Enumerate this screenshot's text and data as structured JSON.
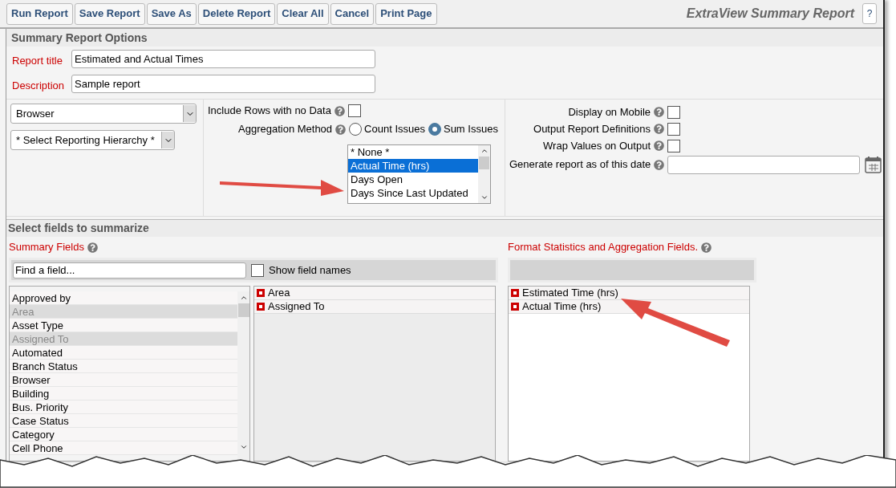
{
  "toolbar": {
    "buttons": [
      "Run Report",
      "Save Report",
      "Save As",
      "Delete Report",
      "Clear All",
      "Cancel",
      "Print Page"
    ],
    "title": "ExtraView Summary Report",
    "help_button": "?"
  },
  "options": {
    "heading": "Summary Report Options",
    "fields": [
      {
        "label": "Report title",
        "value": "Estimated and Actual Times"
      },
      {
        "label": "Description",
        "value": "Sample report"
      }
    ],
    "browser_select": {
      "value": "Browser"
    },
    "hierarchy_select": {
      "value": "* Select Reporting Hierarchy *"
    },
    "include_rows": {
      "label": "Include Rows with no Data",
      "checked": false
    },
    "aggregation": {
      "label": "Aggregation Method",
      "options": [
        {
          "label": "Count Issues",
          "selected": false
        },
        {
          "label": "Sum Issues",
          "selected": true
        }
      ]
    },
    "aggregation_fields": [
      {
        "label": "* None *",
        "selected": false
      },
      {
        "label": "Actual Time (hrs)",
        "selected": true
      },
      {
        "label": "Days Open",
        "selected": false
      },
      {
        "label": "Days Since Last Updated",
        "selected": false
      }
    ],
    "settings": [
      {
        "label": "Display on Mobile",
        "checked": false
      },
      {
        "label": "Output Report Definitions",
        "checked": false
      },
      {
        "label": "Wrap Values on Output",
        "checked": false
      }
    ],
    "date": {
      "label": "Generate report as of this date"
    }
  },
  "fields_section": {
    "heading": "Select fields to summarize",
    "summary_label": "Summary Fields",
    "search": {
      "placeholder": "Find a field..."
    },
    "show_names": {
      "label": "Show field names",
      "checked": false
    },
    "available": [
      {
        "label": "Approved by",
        "disabled": false
      },
      {
        "label": "Area",
        "disabled": true
      },
      {
        "label": "Asset Type",
        "disabled": false
      },
      {
        "label": "Assigned To",
        "disabled": true
      },
      {
        "label": "Automated",
        "disabled": false
      },
      {
        "label": "Branch Status",
        "disabled": false
      },
      {
        "label": "Browser",
        "disabled": false
      },
      {
        "label": "Building",
        "disabled": false
      },
      {
        "label": "Bus. Priority",
        "disabled": false
      },
      {
        "label": "Case Status",
        "disabled": false
      },
      {
        "label": "Category",
        "disabled": false
      },
      {
        "label": "Cell Phone",
        "disabled": false
      }
    ],
    "chosen": [
      "Area",
      "Assigned To"
    ],
    "format_label": "Format Statistics and Aggregation Fields.",
    "format_fields": [
      "Estimated Time (hrs)",
      "Actual Time (hrs)"
    ]
  }
}
